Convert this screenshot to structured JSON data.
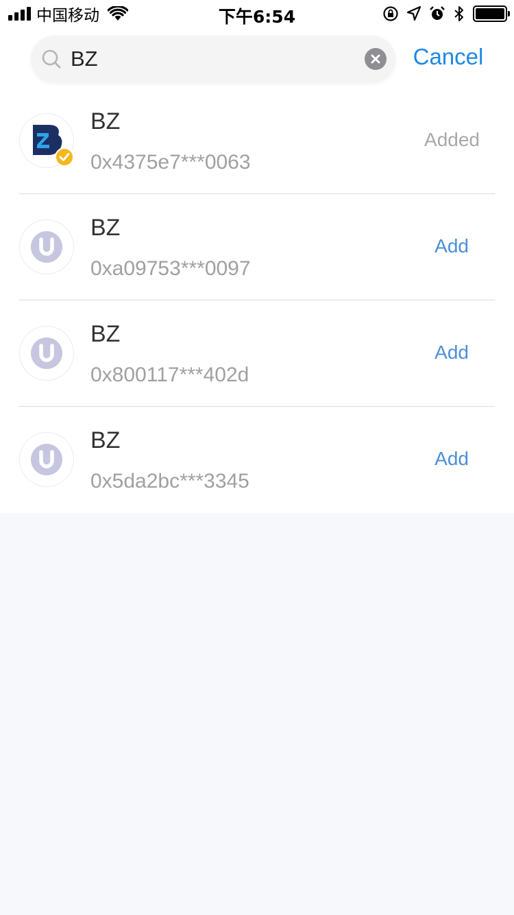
{
  "status_bar": {
    "carrier": "中国移动",
    "time": "下午6:54"
  },
  "search": {
    "value": "BZ",
    "placeholder": "",
    "cancel_label": "Cancel"
  },
  "tokens": [
    {
      "name": "BZ",
      "address": "0x4375e7***0063",
      "action": "Added",
      "logo": "bz-logo-icon",
      "verified": true
    },
    {
      "name": "BZ",
      "address": "0xa09753***0097",
      "action": "Add",
      "logo": "default-token-icon",
      "verified": false
    },
    {
      "name": "BZ",
      "address": "0x800117***402d",
      "action": "Add",
      "logo": "default-token-icon",
      "verified": false
    },
    {
      "name": "BZ",
      "address": "0x5da2bc***3345",
      "action": "Add",
      "logo": "default-token-icon",
      "verified": false
    }
  ],
  "colors": {
    "accent": "#1e88e5",
    "add": "#4a8fd6",
    "added": "#a8a8a8",
    "page_bg": "#f7f8fc",
    "bz_navy": "#1c2f63",
    "bz_blue": "#2ea3e6",
    "verified_gold": "#f5b81c",
    "default_logo": "#c7c6e0"
  }
}
